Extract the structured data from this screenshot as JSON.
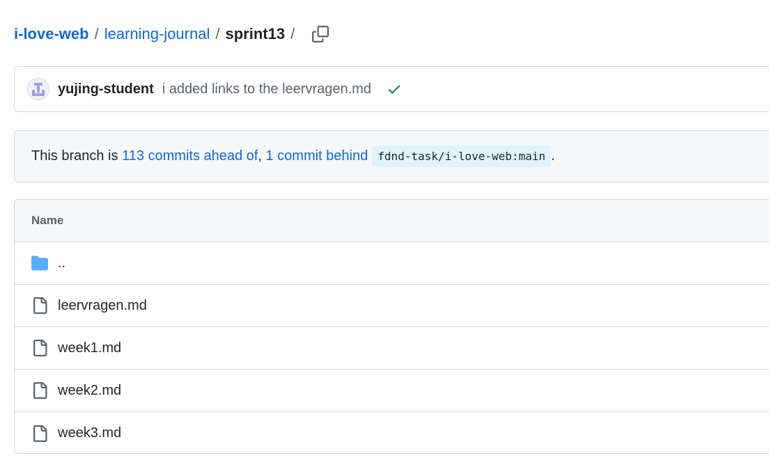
{
  "breadcrumb": {
    "repo": "i-love-web",
    "sep1": "/",
    "folder": "learning-journal",
    "sep2": "/",
    "current": "sprint13",
    "sep3": "/",
    "copy_icon": "copy-icon"
  },
  "commit": {
    "author": "yujing-student",
    "message": "i added links to the leervragen.md",
    "status_icon": "check-icon",
    "status_color": "#1a7f37"
  },
  "branch": {
    "prefix": "This branch is ",
    "ahead": "113 commits ahead of",
    "comma": ", ",
    "behind": "1 commit behind",
    "ref": "fdnd-task/i-love-web:main",
    "suffix": "."
  },
  "files": {
    "header": "Name",
    "rows": [
      {
        "name": "..",
        "icon": "folder-icon"
      },
      {
        "name": "leervragen.md",
        "icon": "file-icon"
      },
      {
        "name": "week1.md",
        "icon": "file-icon"
      },
      {
        "name": "week2.md",
        "icon": "file-icon"
      },
      {
        "name": "week3.md",
        "icon": "file-icon"
      }
    ]
  },
  "colors": {
    "link": "#0969da",
    "folder": "#54aeff",
    "border": "#d1d9e0",
    "muted": "#59636e"
  }
}
